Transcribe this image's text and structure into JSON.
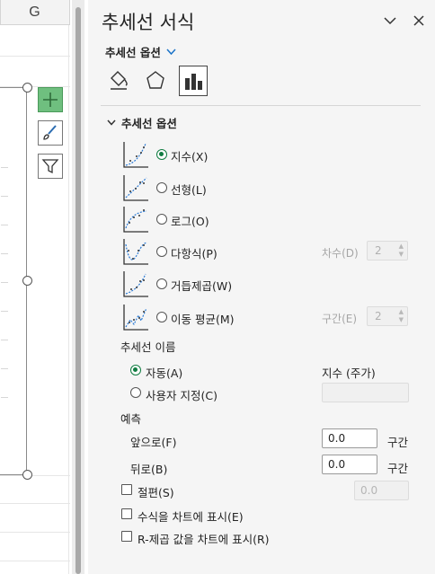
{
  "sheet": {
    "column_letter": "G"
  },
  "pane": {
    "title": "추세선 서식",
    "options_dropdown": "추세선 옵션",
    "category_tabs": [
      "fill-line-icon",
      "effects-icon",
      "trendline-options-icon"
    ],
    "section_title": "추세선 옵션",
    "trend_types": [
      {
        "label": "지수(X)",
        "checked": true
      },
      {
        "label": "선형(L)",
        "checked": false
      },
      {
        "label": "로그(O)",
        "checked": false
      },
      {
        "label": "다항식(P)",
        "checked": false,
        "spin_label": "차수(D)",
        "spin_value": "2"
      },
      {
        "label": "거듭제곱(W)",
        "checked": false
      },
      {
        "label": "이동 평균(M)",
        "checked": false,
        "spin_label": "구간(E)",
        "spin_value": "2"
      }
    ],
    "name": {
      "title": "추세선 이름",
      "auto_label": "자동(A)",
      "auto_value": "지수 (주가)",
      "custom_label": "사용자 지정(C)",
      "custom_value": ""
    },
    "forecast": {
      "title": "예측",
      "forward_label": "앞으로(F)",
      "forward_value": "0.0",
      "forward_unit": "구간",
      "backward_label": "뒤로(B)",
      "backward_value": "0.0",
      "backward_unit": "구간"
    },
    "intercept": {
      "label": "절편(S)",
      "value": "0.0"
    },
    "display_equation": "수식을 차트에 표시(E)",
    "display_r_squared": "R-제곱 값을 차트에 표시(R)"
  },
  "colors": {
    "accent_green": "#107c41",
    "chevron_blue": "#1a73c8",
    "chart_add_green": "#6fbf7f"
  }
}
